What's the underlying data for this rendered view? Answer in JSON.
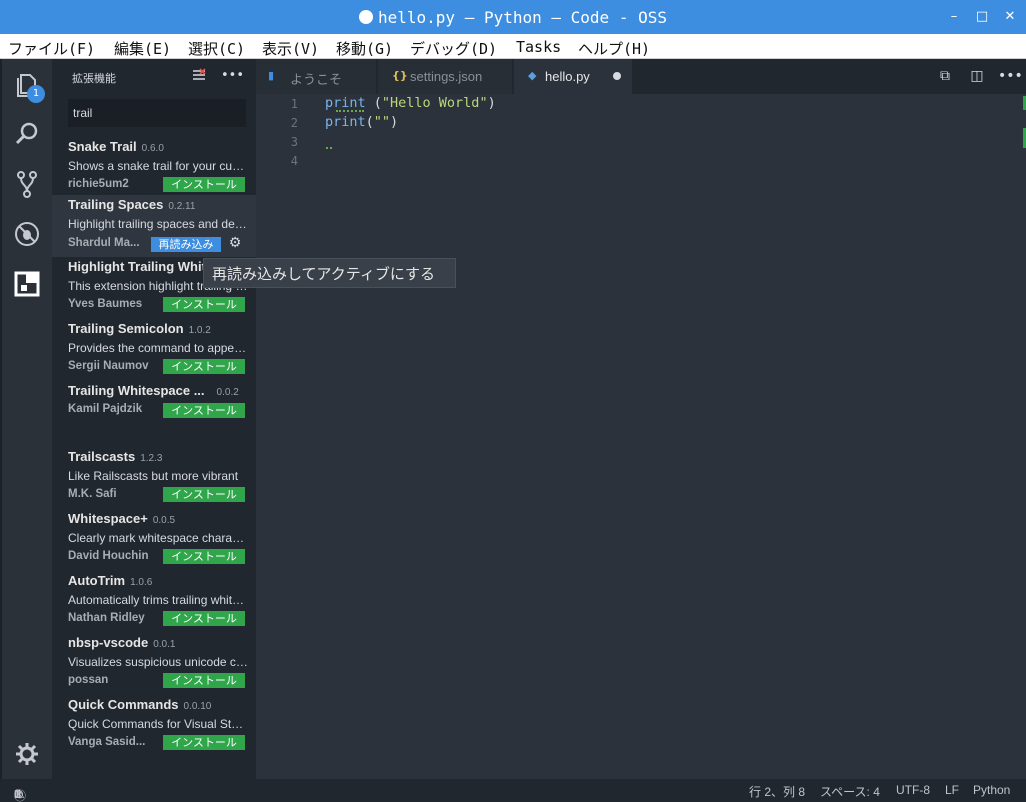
{
  "window": {
    "title": "hello.py — Python — Code - OSS",
    "minimize": "–",
    "maximize": "□",
    "close": "✕"
  },
  "menu": [
    "ファイル(F)",
    "編集(E)",
    "選択(C)",
    "表示(V)",
    "移動(G)",
    "デバッグ(D)",
    "Tasks",
    "ヘルプ(H)"
  ],
  "activity": {
    "explorer_badge": "1",
    "icons": [
      "files-icon",
      "search-icon",
      "source-control-icon",
      "debug-icon",
      "extensions-icon",
      "gear-icon"
    ]
  },
  "sidebar": {
    "title": "拡張機能",
    "search_value": "trail",
    "extensions": [
      {
        "name": "Snake Trail",
        "version": "0.6.0",
        "description": "Shows a snake trail for your cursor",
        "author": "richie5um2",
        "action": "インストール"
      },
      {
        "name": "Trailing Spaces",
        "version": "0.2.11",
        "description": "Highlight trailing spaces and delete them",
        "author": "Shardul Ma...",
        "action": "再読み込み"
      },
      {
        "name": "Highlight Trailing White Spaces",
        "version": "",
        "description": "This extension highlight trailing white spaces",
        "author": "Yves Baumes",
        "action": "インストール"
      },
      {
        "name": "Trailing Semicolon",
        "version": "1.0.2",
        "description": "Provides the command to append a semicolon",
        "author": "Sergii Naumov",
        "action": "インストール"
      },
      {
        "name": "Trailing Whitespace ...",
        "version": "0.0.2",
        "description": "",
        "author": "Kamil Pajdzik",
        "action": "インストール"
      },
      {
        "name": "Trailscasts",
        "version": "1.2.3",
        "description": "Like Railscasts but more vibrant",
        "author": "M.K. Safi",
        "action": "インストール"
      },
      {
        "name": "Whitespace+",
        "version": "0.0.5",
        "description": "Clearly mark whitespace characters",
        "author": "David Houchin",
        "action": "インストール"
      },
      {
        "name": "AutoTrim",
        "version": "1.0.6",
        "description": "Automatically trims trailing whitespace",
        "author": "Nathan Ridley",
        "action": "インストール"
      },
      {
        "name": "nbsp-vscode",
        "version": "0.0.1",
        "description": "Visualizes suspicious unicode characters",
        "author": "possan",
        "action": "インストール"
      },
      {
        "name": "Quick Commands",
        "version": "0.0.10",
        "description": "Quick Commands for Visual Studio Code",
        "author": "Vanga Sasid...",
        "action": "インストール"
      }
    ]
  },
  "tabs": [
    {
      "label": "ようこそ",
      "icon": "welcome-icon"
    },
    {
      "label": "settings.json",
      "icon": "json-icon"
    },
    {
      "label": "hello.py",
      "icon": "python-icon"
    }
  ],
  "editor": {
    "line_numbers": [
      "1",
      "2",
      "3",
      "4"
    ],
    "line1": {
      "kw": "print",
      "rest": " (",
      "str": "\"Hello World\"",
      "end": ")"
    },
    "line2": {
      "kw": "print",
      "rest": "(",
      "str": "\"\"",
      "end": ")"
    }
  },
  "tooltip": "再読み込みしてアクティブにする",
  "status": {
    "errors": "1",
    "warnings": "0",
    "infos": "3",
    "position": "行 2、列 8",
    "spaces": "スペース: 4",
    "encoding": "UTF-8",
    "eol": "LF",
    "language": "Python"
  },
  "colors": {
    "accent": "#3d8ee0",
    "install": "#2fa64a",
    "editor_bg": "#2b323b"
  }
}
